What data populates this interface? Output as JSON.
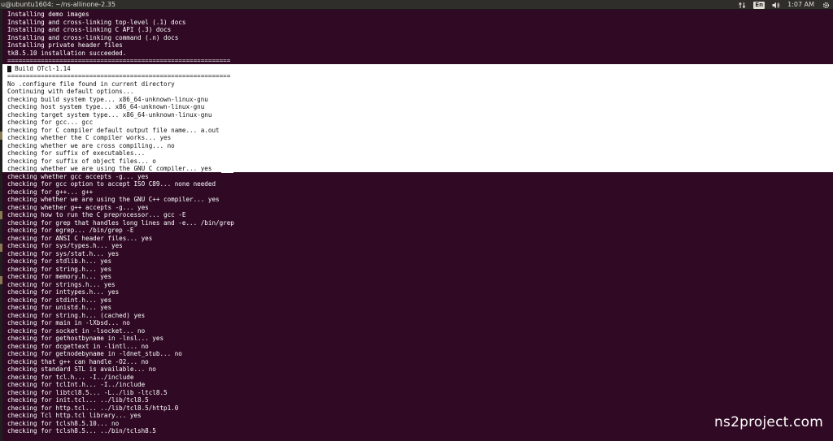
{
  "window": {
    "title": "u@ubuntu1604: ~/ns-allinone-2.35"
  },
  "indicators": {
    "network_icon": "network-updown-icon",
    "language": "En",
    "volume_icon": "volume-icon",
    "clock": "1:07 AM",
    "settings_icon": "gear-icon"
  },
  "terminal": {
    "lines": [
      "Installing demo images",
      "Installing and cross-linking top-level (.1) docs",
      "Installing and cross-linking C API (.3) docs",
      "Installing and cross-linking command (.n) docs",
      "Installing private header files",
      "tk8.5.10 installation succeeded.",
      "============================================================",
      "  Build OTcl-1.14",
      "============================================================",
      "No .configure file found in current directory",
      "Continuing with default options...",
      "checking build system type... x86_64-unknown-linux-gnu",
      "checking host system type... x86_64-unknown-linux-gnu",
      "checking target system type... x86_64-unknown-linux-gnu",
      "checking for gcc... gcc",
      "checking for C compiler default output file name... a.out",
      "checking whether the C compiler works... yes",
      "checking whether we are cross compiling... no",
      "checking for suffix of executables...",
      "checking for suffix of object files... o",
      "checking whether we are using the GNU C compiler... yes",
      "checking whether gcc accepts -g... yes",
      "checking for gcc option to accept ISO C89... none needed",
      "checking for g++... g++",
      "checking whether we are using the GNU C++ compiler... yes",
      "checking whether g++ accepts -g... yes",
      "checking how to run the C preprocessor... gcc -E",
      "checking for grep that handles long lines and -e... /bin/grep",
      "checking for egrep... /bin/grep -E",
      "checking for ANSI C header files... yes",
      "checking for sys/types.h... yes",
      "checking for sys/stat.h... yes",
      "checking for stdlib.h... yes",
      "checking for string.h... yes",
      "checking for memory.h... yes",
      "checking for strings.h... yes",
      "checking for inttypes.h... yes",
      "checking for stdint.h... yes",
      "checking for unistd.h... yes",
      "checking for string.h... (cached) yes",
      "checking for main in -lXbsd... no",
      "checking for socket in -lsocket... no",
      "checking for gethostbyname in -lnsl... yes",
      "checking for dcgettext in -lintl... no",
      "checking for getnodebyname in -ldnet_stub... no",
      "checking that g++ can handle -O2... no",
      "checking standard STL is available... no",
      "checking for tcl.h... -I../include",
      "checking for tclInt.h... -I../include",
      "checking for libtcl8.5... -L../lib -ltcl8.5",
      "checking for init.tcl... ../lib/tcl8.5",
      "checking for http.tcl... ../lib/tcl8.5/http1.0",
      "checking Tcl http.tcl library... yes",
      "checking for tclsh8.5.10... no",
      "checking for tclsh8.5... ../bin/tclsh8.5"
    ]
  },
  "watermark": "ns2project.com",
  "colors": {
    "terminal_bg": "#300a24",
    "terminal_fg": "#ffffff",
    "selection_bg": "#ffffff",
    "selection_fg": "#141414",
    "topbar_bg": "#2f2e2b"
  }
}
